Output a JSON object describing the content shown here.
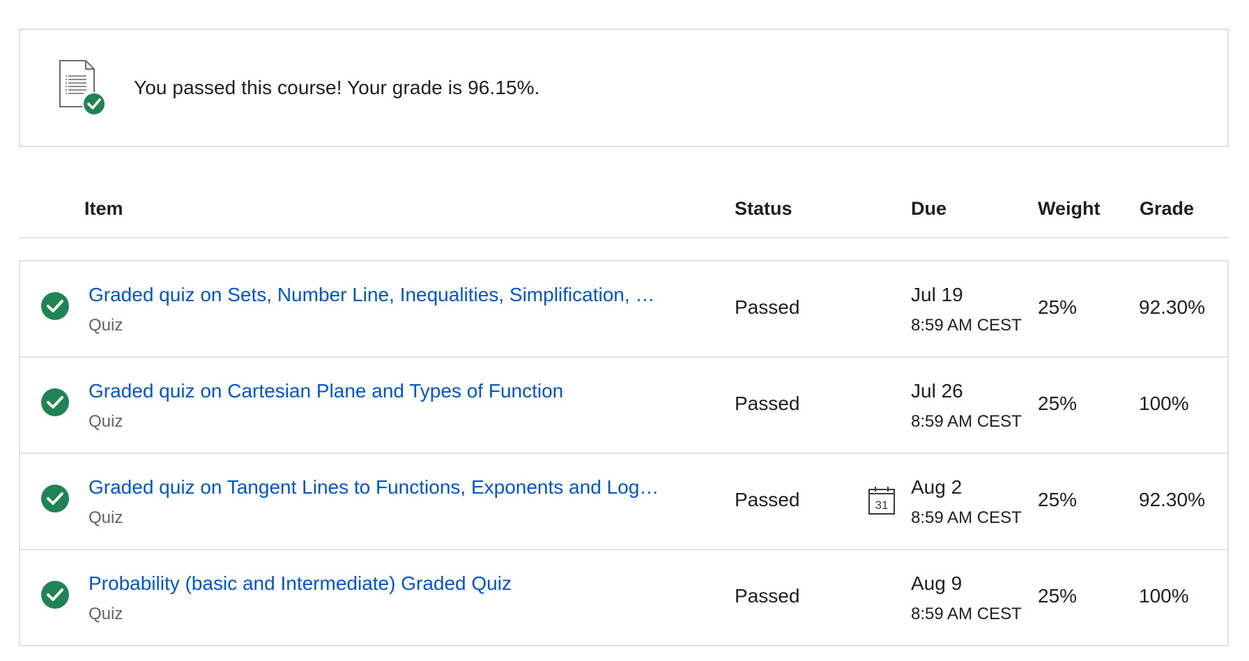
{
  "banner": {
    "message": "You passed this course! Your grade is 96.15%.",
    "icon": "document-check-icon"
  },
  "table": {
    "headers": {
      "item": "Item",
      "status": "Status",
      "due": "Due",
      "weight": "Weight",
      "grade": "Grade"
    },
    "rows": [
      {
        "title": "Graded quiz on Sets, Number Line, Inequalities, Simplification, and Sigma Notation",
        "type": "Quiz",
        "status": "Passed",
        "due_date": "Jul 19",
        "due_time": "8:59 AM CEST",
        "weight": "25%",
        "grade": "92.30%",
        "calendar_icon": false
      },
      {
        "title": "Graded quiz on Cartesian Plane and Types of Function",
        "type": "Quiz",
        "status": "Passed",
        "due_date": "Jul 26",
        "due_time": "8:59 AM CEST",
        "weight": "25%",
        "grade": "100%",
        "calendar_icon": false
      },
      {
        "title": "Graded quiz on Tangent Lines to Functions, Exponents and Logarithms",
        "type": "Quiz",
        "status": "Passed",
        "due_date": "Aug 2",
        "due_time": "8:59 AM CEST",
        "weight": "25%",
        "grade": "92.30%",
        "calendar_icon": true,
        "calendar_label": "31"
      },
      {
        "title": "Probability (basic and Intermediate) Graded Quiz",
        "type": "Quiz",
        "status": "Passed",
        "due_date": "Aug 9",
        "due_time": "8:59 AM CEST",
        "weight": "25%",
        "grade": "100%",
        "calendar_icon": false
      }
    ]
  },
  "colors": {
    "link": "#0056d2",
    "success": "#1f8354",
    "border": "#e1e1e1",
    "muted_text": "#636363"
  }
}
